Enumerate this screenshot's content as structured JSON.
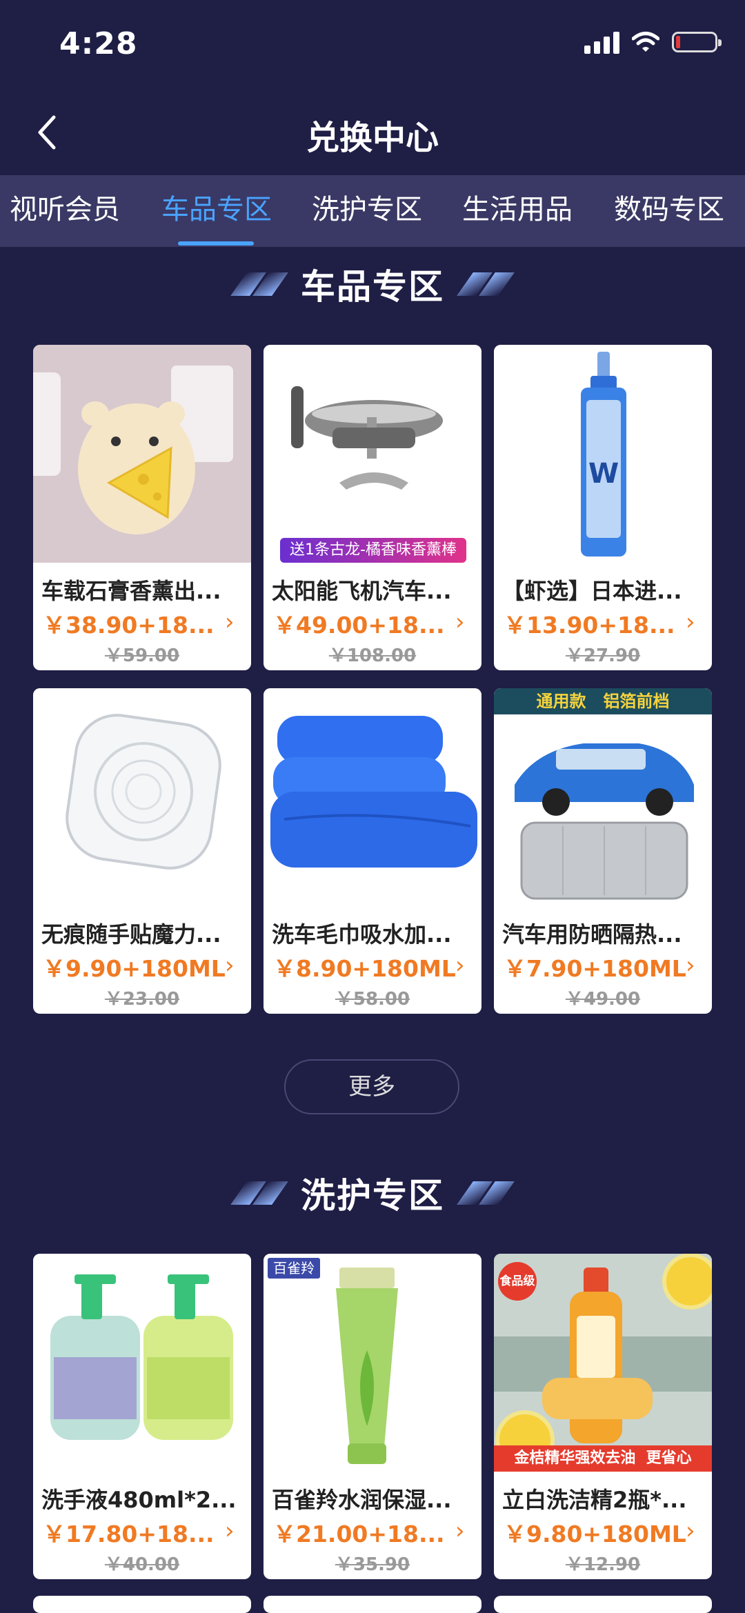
{
  "status_bar": {
    "time": "4:28"
  },
  "header": {
    "title": "兑换中心"
  },
  "tabs": [
    "视听会员",
    "车品专区",
    "洗护专区",
    "生活用品",
    "数码专区"
  ],
  "active_tab": "车品专区",
  "sections": [
    {
      "title": "车品专区",
      "products": [
        {
          "name": "车载石膏香薰出...",
          "price": "￥38.90+18...",
          "original": "￥59.00"
        },
        {
          "name": "太阳能飞机汽车...",
          "price": "￥49.00+18...",
          "original": "￥108.00",
          "banner": "送1条古龙-橘香味香薰棒"
        },
        {
          "name": "【虾选】日本进...",
          "price": "￥13.90+18...",
          "original": "￥27.90"
        },
        {
          "name": "无痕随手贴魔力...",
          "price": "￥9.90+180ML",
          "original": "￥23.00"
        },
        {
          "name": "洗车毛巾吸水加...",
          "price": "￥8.90+180ML",
          "original": "￥58.00"
        },
        {
          "name": "汽车用防晒隔热...",
          "price": "￥7.90+180ML",
          "original": "￥49.00",
          "banner": "通用款   铝箔前档"
        }
      ],
      "more_label": "更多"
    },
    {
      "title": "洗护专区",
      "products": [
        {
          "name": "洗手液480ml*2...",
          "price": "￥17.80+18...",
          "original": "￥40.00"
        },
        {
          "name": "百雀羚水润保湿...",
          "price": "￥21.00+18...",
          "original": "￥35.90",
          "badge": "百雀羚"
        },
        {
          "name": "立白洗洁精2瓶*...",
          "price": "￥9.80+180ML",
          "original": "￥12.90",
          "badge": "食品级",
          "banner": "金桔精华强效去油  更省心"
        }
      ]
    }
  ],
  "colors": {
    "background": "#1f1e45",
    "tab_bar": "#3a3965",
    "accent": "#4aa3ff",
    "price": "#f07a23"
  }
}
